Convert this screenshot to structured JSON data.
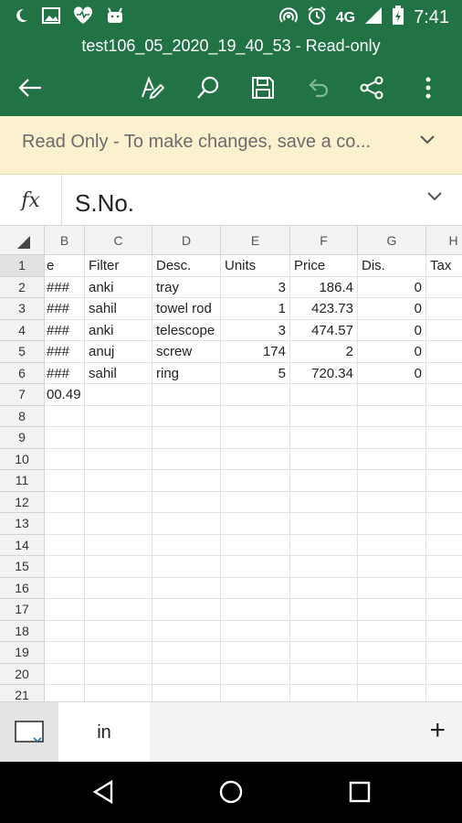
{
  "status_bar": {
    "network": "4G",
    "time": "7:41"
  },
  "toolbar": {
    "title": "test106_05_2020_19_40_53 - Read-only"
  },
  "banner": {
    "text": "Read Only - To make changes, save a co..."
  },
  "formula_bar": {
    "fx": "fx",
    "value": "S.No."
  },
  "grid": {
    "columns": [
      "B",
      "C",
      "D",
      "E",
      "F",
      "G",
      "H"
    ],
    "rows": [
      "1",
      "2",
      "3",
      "4",
      "5",
      "6",
      "7",
      "8",
      "9",
      "10",
      "11",
      "12",
      "13",
      "14",
      "15",
      "16",
      "17",
      "18",
      "19",
      "20",
      "21"
    ],
    "header_row": {
      "b": "e",
      "c": "Filter",
      "d": "Desc.",
      "e": "Units",
      "f": "Price",
      "g": "Dis.",
      "h": "Tax"
    },
    "data": [
      {
        "b": "###",
        "c": "anki",
        "d": "tray",
        "e": "3",
        "f": "186.4",
        "g": "0"
      },
      {
        "b": "###",
        "c": "sahil",
        "d": "towel rod",
        "e": "1",
        "f": "423.73",
        "g": "0"
      },
      {
        "b": "###",
        "c": "anki",
        "d": "telescope",
        "e": "3",
        "f": "474.57",
        "g": "0"
      },
      {
        "b": "###",
        "c": "anuj",
        "d": "screw",
        "e": "174",
        "f": "2",
        "g": "0"
      },
      {
        "b": "###",
        "c": "sahil",
        "d": "ring",
        "e": "5",
        "f": "720.34",
        "g": "0"
      }
    ],
    "row7_b": "00.49"
  },
  "sheet_tabs": {
    "active": "in",
    "add": "+"
  },
  "colors": {
    "accent": "#217346",
    "banner": "#fbf1cf"
  }
}
